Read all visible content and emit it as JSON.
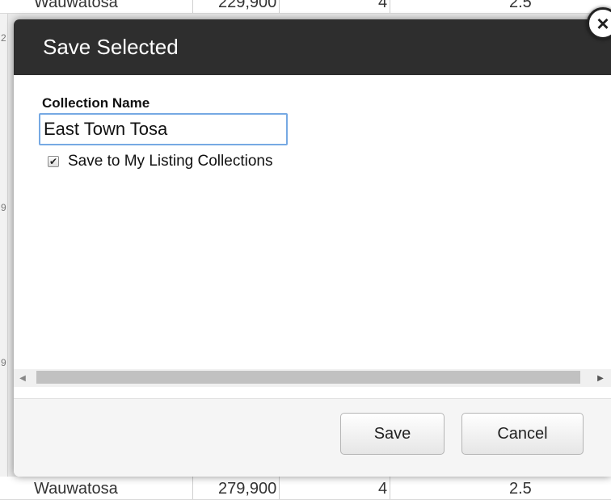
{
  "background": {
    "top_row": {
      "city": "Wauwatosa",
      "price": "229,900",
      "beds": "4",
      "baths": "2.5"
    },
    "bottom_row": {
      "city": "Wauwatosa",
      "price": "279,900",
      "beds": "4",
      "baths": "2.5"
    }
  },
  "dialog": {
    "title": "Save Selected",
    "close_icon": "close-icon",
    "field_label": "Collection Name",
    "collection_name_value": "East Town Tosa",
    "checkbox_checked": true,
    "checkbox_label": "Save to My Listing Collections",
    "save_label": "Save",
    "cancel_label": "Cancel"
  },
  "colors": {
    "header_bg": "#2e2e2e",
    "input_focus_border": "#76a9e3",
    "footer_bg": "#f5f5f5"
  }
}
